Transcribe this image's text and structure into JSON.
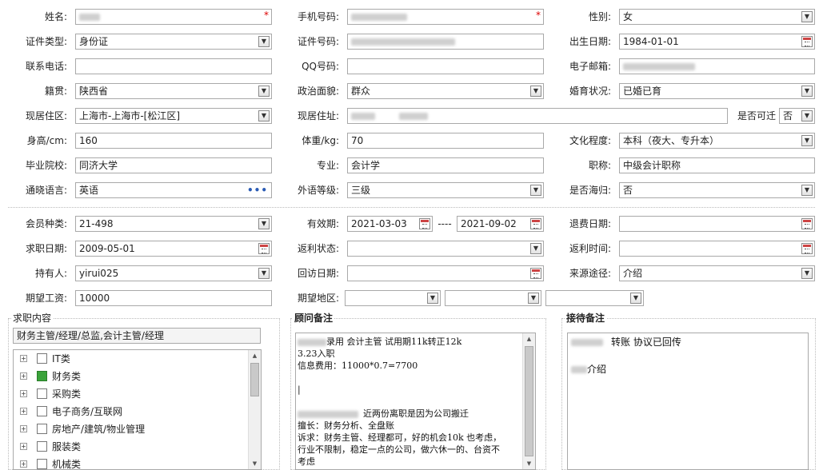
{
  "form": {
    "name": {
      "label": "姓名:",
      "required": "*"
    },
    "mobile": {
      "label": "手机号码:",
      "required": "*"
    },
    "gender": {
      "label": "性别:",
      "value": "女"
    },
    "id_type": {
      "label": "证件类型:",
      "value": "身份证"
    },
    "id_number": {
      "label": "证件号码:"
    },
    "birth_date": {
      "label": "出生日期:",
      "value": "1984-01-01"
    },
    "phone": {
      "label": "联系电话:",
      "value": ""
    },
    "qq": {
      "label": "QQ号码:",
      "value": ""
    },
    "email": {
      "label": "电子邮箱:"
    },
    "native_place": {
      "label": "籍贯:",
      "value": "陕西省"
    },
    "political": {
      "label": "政治面貌:",
      "value": "群众"
    },
    "marital": {
      "label": "婚育状况:",
      "value": "已婚已育"
    },
    "residence": {
      "label": "现居住区:",
      "value": "上海市-上海市-[松江区]"
    },
    "address": {
      "label": "现居住址:"
    },
    "relocate": {
      "label": "是否可迁",
      "value": "否"
    },
    "height": {
      "label": "身高/cm:",
      "value": "160"
    },
    "weight": {
      "label": "体重/kg:",
      "value": "70"
    },
    "education": {
      "label": "文化程度:",
      "value": "本科（夜大、专升本）"
    },
    "school": {
      "label": "毕业院校:",
      "value": "同济大学"
    },
    "major": {
      "label": "专业:",
      "value": "会计学"
    },
    "title": {
      "label": "职称:",
      "value": "中级会计职称"
    },
    "language": {
      "label": "通晓语言:",
      "value": "英语",
      "more": "•••"
    },
    "foreign_level": {
      "label": "外语等级:",
      "value": "三级"
    },
    "overseas": {
      "label": "是否海归:",
      "value": "否"
    }
  },
  "membership": {
    "member_type": {
      "label": "会员种类:",
      "value": "21-498"
    },
    "validity": {
      "label": "有效期:",
      "start": "2021-03-03",
      "dash": "----",
      "end": "2021-09-02"
    },
    "refund_date": {
      "label": "退费日期:",
      "value": ""
    },
    "job_date": {
      "label": "求职日期:",
      "value": "2009-05-01"
    },
    "rebate_status": {
      "label": "返利状态:",
      "value": ""
    },
    "rebate_time": {
      "label": "返利时间:",
      "value": ""
    },
    "holder": {
      "label": "持有人:",
      "value": "yirui025"
    },
    "visit_date": {
      "label": "回访日期:",
      "value": ""
    },
    "source": {
      "label": "来源途径:",
      "value": "介绍"
    },
    "salary": {
      "label": "期望工资:",
      "value": "10000"
    },
    "region": {
      "label": "期望地区:"
    }
  },
  "job_content": {
    "title": "求职内容",
    "selected": "财务主管/经理/总监,会计主管/经理",
    "tree": [
      {
        "label": "IT类",
        "checked": false
      },
      {
        "label": "财务类",
        "checked": true
      },
      {
        "label": "采购类",
        "checked": false
      },
      {
        "label": "电子商务/互联网",
        "checked": false
      },
      {
        "label": "房地产/建筑/物业管理",
        "checked": false
      },
      {
        "label": "服装类",
        "checked": false
      },
      {
        "label": "机械类",
        "checked": false
      }
    ]
  },
  "consultant_notes": {
    "title": "顾问备注",
    "l1": "录用 会计主管  试用期11k转正12k",
    "l2": "3.23入职",
    "l3": "信息费用：11000*0.7=7700",
    "l4": "|",
    "l5": "近两份离职是因为公司搬迁",
    "l6": "擅长：财务分析、全盘账",
    "l7": "诉求：财务主管、经理都可，好的机会10k 也考虑，",
    "l8": "行业不限制，稳定一点的公司，做六休一的、台资不",
    "l9": "考虑"
  },
  "reception_notes": {
    "title": "接待备注",
    "l1": "转账  协议已回传",
    "l2": "介绍"
  },
  "colors": {
    "required": "#dd0000",
    "checked": "#3aa33a",
    "link": "#2a5bb5"
  }
}
